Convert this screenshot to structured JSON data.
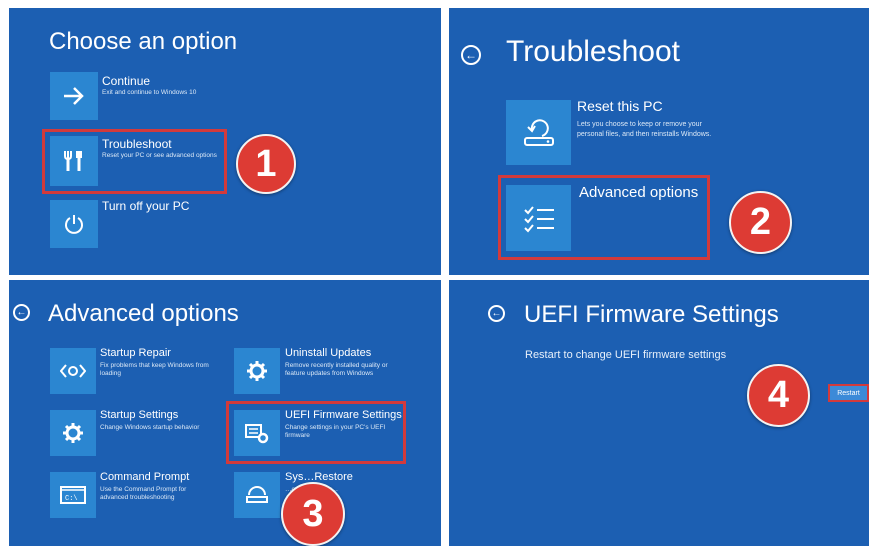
{
  "panel1": {
    "title": "Choose an option",
    "options": [
      {
        "label": "Continue",
        "desc": "Exit and continue to Windows 10",
        "icon": "arrow-right-icon"
      },
      {
        "label": "Troubleshoot",
        "desc": "Reset your PC or see advanced options",
        "icon": "tools-icon"
      },
      {
        "label": "Turn off your PC",
        "desc": "",
        "icon": "power-icon"
      }
    ],
    "badge": "1"
  },
  "panel2": {
    "title": "Troubleshoot",
    "options": [
      {
        "label": "Reset this PC",
        "desc": "Lets you choose to keep or remove your personal files, and then reinstalls Windows.",
        "icon": "reset-pc-icon"
      },
      {
        "label": "Advanced options",
        "desc": "",
        "icon": "checklist-icon"
      }
    ],
    "badge": "2"
  },
  "panel3": {
    "title": "Advanced options",
    "options": [
      {
        "label": "Startup Repair",
        "desc": "Fix problems that keep Windows from loading",
        "icon": "startup-repair-icon"
      },
      {
        "label": "Uninstall Updates",
        "desc": "Remove recently installed quality or feature updates from Windows",
        "icon": "gear-icon"
      },
      {
        "label": "Startup Settings",
        "desc": "Change Windows startup behavior",
        "icon": "gear-icon"
      },
      {
        "label": "UEFI Firmware Settings",
        "desc": "Change settings in your PC's UEFI firmware",
        "icon": "uefi-chip-icon"
      },
      {
        "label": "Command Prompt",
        "desc": "Use the Command Prompt for advanced troubleshooting",
        "icon": "command-prompt-icon"
      },
      {
        "label": "System Restore",
        "desc": "…orded on your…",
        "icon": "system-restore-icon",
        "label_visible": "Sys…Restore"
      }
    ],
    "badge": "3"
  },
  "panel4": {
    "title": "UEFI Firmware Settings",
    "subtitle": "Restart to change UEFI firmware settings",
    "restart": "Restart",
    "badge": "4"
  },
  "colors": {
    "background": "#1c5fb2",
    "tile": "#2b86d1",
    "highlight": "#d23a3c",
    "badge": "#dd3b34"
  }
}
